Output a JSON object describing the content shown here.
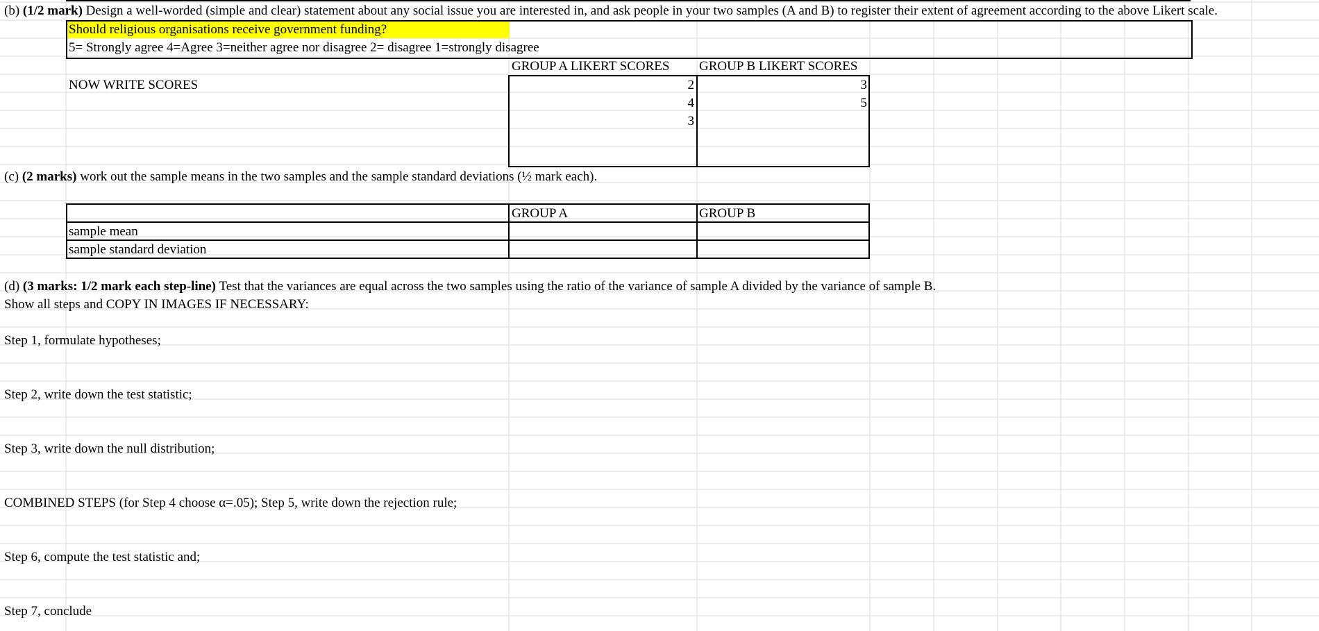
{
  "sheet": {
    "part_b": {
      "label": "(b)",
      "marks": "(1/2 mark)",
      "text": "Design a well-worded (simple and clear) statement about any social issue you are interested in, and ask people in your two samples (A and B) to register their extent of agreement according to the above Likert scale.",
      "statement": "Should religious organisations receive government funding?",
      "scale": "5= Strongly agree 4=Agree 3=neither agree nor disagree 2= disagree 1=strongly disagree",
      "group_a_header": "GROUP A LIKERT SCORES",
      "group_b_header": "GROUP B LIKERT SCORES",
      "now_write": "NOW WRITE SCORES",
      "group_a_scores": [
        "2",
        "4",
        "3"
      ],
      "group_b_scores": [
        "3",
        "5"
      ]
    },
    "part_c": {
      "label": "(c)",
      "marks": "(2 marks)",
      "text": "work out the sample means in the two samples and the sample standard deviations (½ mark each).",
      "col_a": "GROUP A",
      "col_b": "GROUP B",
      "row_mean": "sample mean",
      "row_sd": "sample standard deviation"
    },
    "part_d": {
      "label": "(d)",
      "marks": "(3 marks: 1/2 mark each step-line)",
      "text": "Test that the variances are equal across the two samples using the ratio of the variance of sample A divided by the variance of sample B.",
      "show": "Show all steps and COPY IN IMAGES IF NECESSARY:",
      "step1": "Step 1, formulate hypotheses;",
      "step2": "Step 2, write down the test statistic;",
      "step3": "Step 3, write down the null distribution;",
      "combined": "COMBINED STEPS (for Step 4 choose α=.05); Step 5, write down the rejection rule;",
      "step6": "Step 6, compute the test statistic and;",
      "step7": "Step 7, conclude"
    },
    "colors": {
      "highlight": "#ffff00",
      "gridline": "#d9d9d9"
    }
  }
}
